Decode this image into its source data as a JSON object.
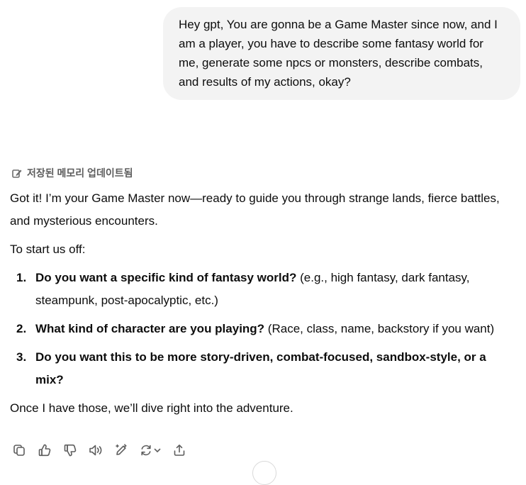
{
  "user_message": {
    "text": "Hey gpt, You are gonna be a Game Master since now, and I am a player, you have to describe some fantasy world for me, generate some npcs or monsters, describe combats, and results of my actions, okay?"
  },
  "memory_notice": {
    "icon": "memory-pencil-icon",
    "label": "저장된 메모리 업데이트됨"
  },
  "assistant_message": {
    "intro": "Got it! I’m your Game Master now—ready to guide you through strange lands, fierce battles, and mysterious encounters.",
    "lead": "To start us off:",
    "questions": [
      {
        "number": "1.",
        "bold": "Do you want a specific kind of fantasy world?",
        "rest": " (e.g., high fantasy, dark fantasy, steampunk, post-apocalyptic, etc.)"
      },
      {
        "number": "2.",
        "bold": "What kind of character are you playing?",
        "rest": " (Race, class, name, backstory if you want)"
      },
      {
        "number": "3.",
        "bold": "Do you want this to be more story-driven, combat-focused, sandbox-style, or a mix?",
        "rest": ""
      }
    ],
    "outro": "Once I have those, we’ll dive right into the adventure."
  },
  "action_bar": {
    "icons": [
      "copy-icon",
      "thumbs-up-icon",
      "thumbs-down-icon",
      "read-aloud-icon",
      "edit-canvas-icon",
      "regenerate-icon",
      "share-icon"
    ]
  },
  "colors": {
    "bubble": "#f3f3f3",
    "text": "#0d0d0d",
    "muted": "#5d5d5d"
  }
}
